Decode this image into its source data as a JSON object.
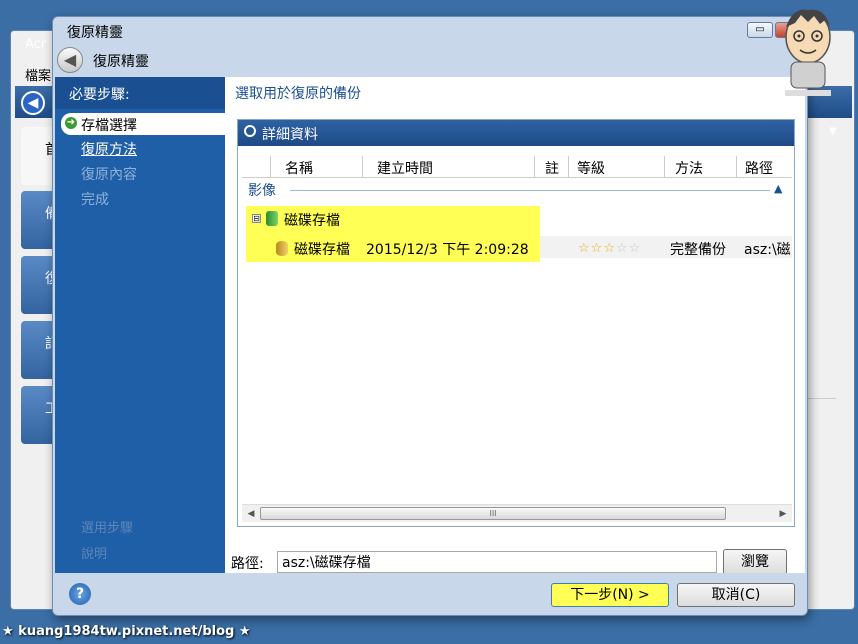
{
  "background_app": {
    "title": "Acr",
    "menu": "檔案",
    "side_items": [
      "首",
      "備",
      "復",
      "記",
      "工"
    ]
  },
  "dialog": {
    "title": "復原精靈",
    "header_title": "復原精靈",
    "window_buttons": {
      "minimize": "▭",
      "close": "✕"
    }
  },
  "sidebar": {
    "heading": "必要步驟:",
    "steps": [
      {
        "label": "存檔選擇",
        "state": "current"
      },
      {
        "label": "復原方法",
        "state": "link"
      },
      {
        "label": "復原內容",
        "state": "disabled"
      },
      {
        "label": "完成",
        "state": "disabled"
      }
    ],
    "footer": [
      "選用步驟",
      "說明"
    ]
  },
  "content": {
    "title": "選取用於復原的備份",
    "details_header": "詳細資料",
    "columns": [
      "名稱",
      "建立時間",
      "註",
      "等級",
      "方法",
      "路徑"
    ],
    "group_label": "影像",
    "archive": {
      "name": "磁碟存檔",
      "expand": "⊟"
    },
    "backup": {
      "name": "磁碟存檔",
      "created": "2015/12/3 下午 2:09:28",
      "rating": 3,
      "rating_max": 5,
      "method": "完整備份",
      "path": "asz:\\磁"
    },
    "scroll_thumb": "III"
  },
  "path_bar": {
    "label": "路徑:",
    "value": "asz:\\磁碟存檔",
    "browse": "瀏覽"
  },
  "footer": {
    "help": "?",
    "next": "下一步(N) >",
    "cancel": "取消(C)"
  },
  "watermark": "★ kuang1984tw.pixnet.net/blog ★",
  "colors": {
    "highlight": "#ffff55",
    "sidebar": "#1f5fa8",
    "accent": "#1a4f91"
  }
}
